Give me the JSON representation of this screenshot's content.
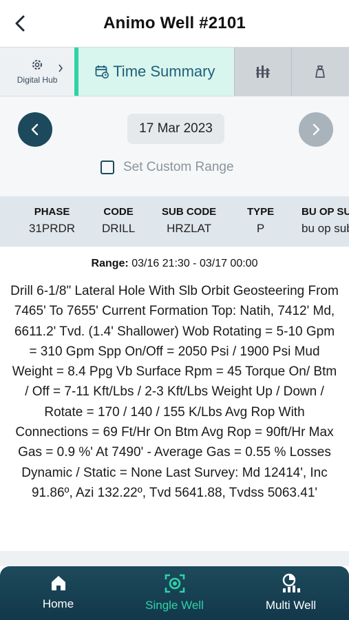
{
  "header": {
    "title": "Animo Well #2101"
  },
  "tabs": {
    "hub_label": "Digital Hub",
    "active_label": "Time Summary"
  },
  "date": {
    "value": "17 Mar 2023",
    "custom_range_label": "Set Custom Range"
  },
  "table": {
    "headers": [
      "PHASE",
      "CODE",
      "SUB CODE",
      "TYPE",
      "BU OP SUB"
    ],
    "values": [
      "31PRDR",
      "DRILL",
      "HRZLAT",
      "P",
      "bu op sub"
    ]
  },
  "entry": {
    "range_label": "Range:",
    "range_value": "03/16 21:30 - 03/17 00:00",
    "description": "Drill 6-1/8\" Lateral Hole With Slb Orbit Geosteering From 7465' To 7655' Current Formation Top: Natih, 7412' Md, 6611.2' Tvd. (1.4' Shallower) Wob Rotating = 5-10 Gpm = 310 Gpm Spp On/Off = 2050 Psi / 1900 Psi Mud Weight = 8.4 Ppg Vb Surface Rpm = 45 Torque On/ Btm / Off = 7-11 Kft/Lbs / 2-3 Kft/Lbs Weight Up / Down / Rotate = 170 / 140 / 155 K/Lbs Avg Rop With Connections = 69 Ft/Hr On Btm Avg Rop = 90ft/Hr Max Gas = 0.9 %' At 7490' - Average Gas = 0.55 % Losses Dynamic / Static = None Last Survey: Md 12414', Inc 91.86º, Azi 132.22º, Tvd 5641.88, Tvdss 5063.41'"
  },
  "bottom_nav": {
    "home": "Home",
    "single_well": "Single Well",
    "multi_well": "Multi Well"
  },
  "colors": {
    "primary": "#1c4a5c",
    "accent": "#2ed3a7",
    "tab_active_bg": "#d8f5ee"
  }
}
